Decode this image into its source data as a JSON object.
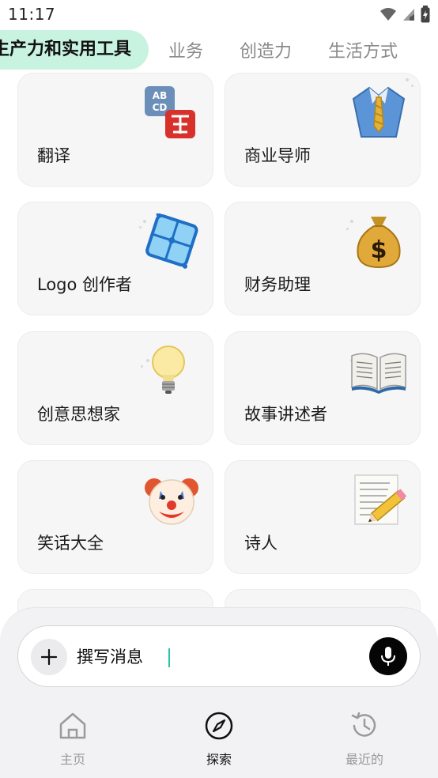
{
  "status_bar": {
    "time": "11:17"
  },
  "tabs": [
    {
      "label": "生产力和实用工具",
      "active": true
    },
    {
      "label": "业务",
      "active": false
    },
    {
      "label": "创造力",
      "active": false
    },
    {
      "label": "生活方式",
      "active": false
    }
  ],
  "cards": [
    {
      "label": "翻译",
      "icon": "translate-abc-icon"
    },
    {
      "label": "商业导师",
      "icon": "shirt-tie-icon"
    },
    {
      "label": "Logo 创作者",
      "icon": "blue-tile-icon"
    },
    {
      "label": "财务助理",
      "icon": "money-bag-icon"
    },
    {
      "label": "创意思想家",
      "icon": "light-bulb-icon"
    },
    {
      "label": "故事讲述者",
      "icon": "open-book-icon"
    },
    {
      "label": "笑话大全",
      "icon": "clown-face-icon"
    },
    {
      "label": "诗人",
      "icon": "memo-pencil-icon"
    }
  ],
  "composer": {
    "placeholder": "撰写消息",
    "value": ""
  },
  "nav": {
    "home": "主页",
    "explore": "探索",
    "recent": "最近的"
  },
  "colors": {
    "active_tab_bg": "#c9f3e1",
    "card_bg": "#f6f6f6",
    "mic_bg": "#050505",
    "caret": "#2bc2aa"
  }
}
